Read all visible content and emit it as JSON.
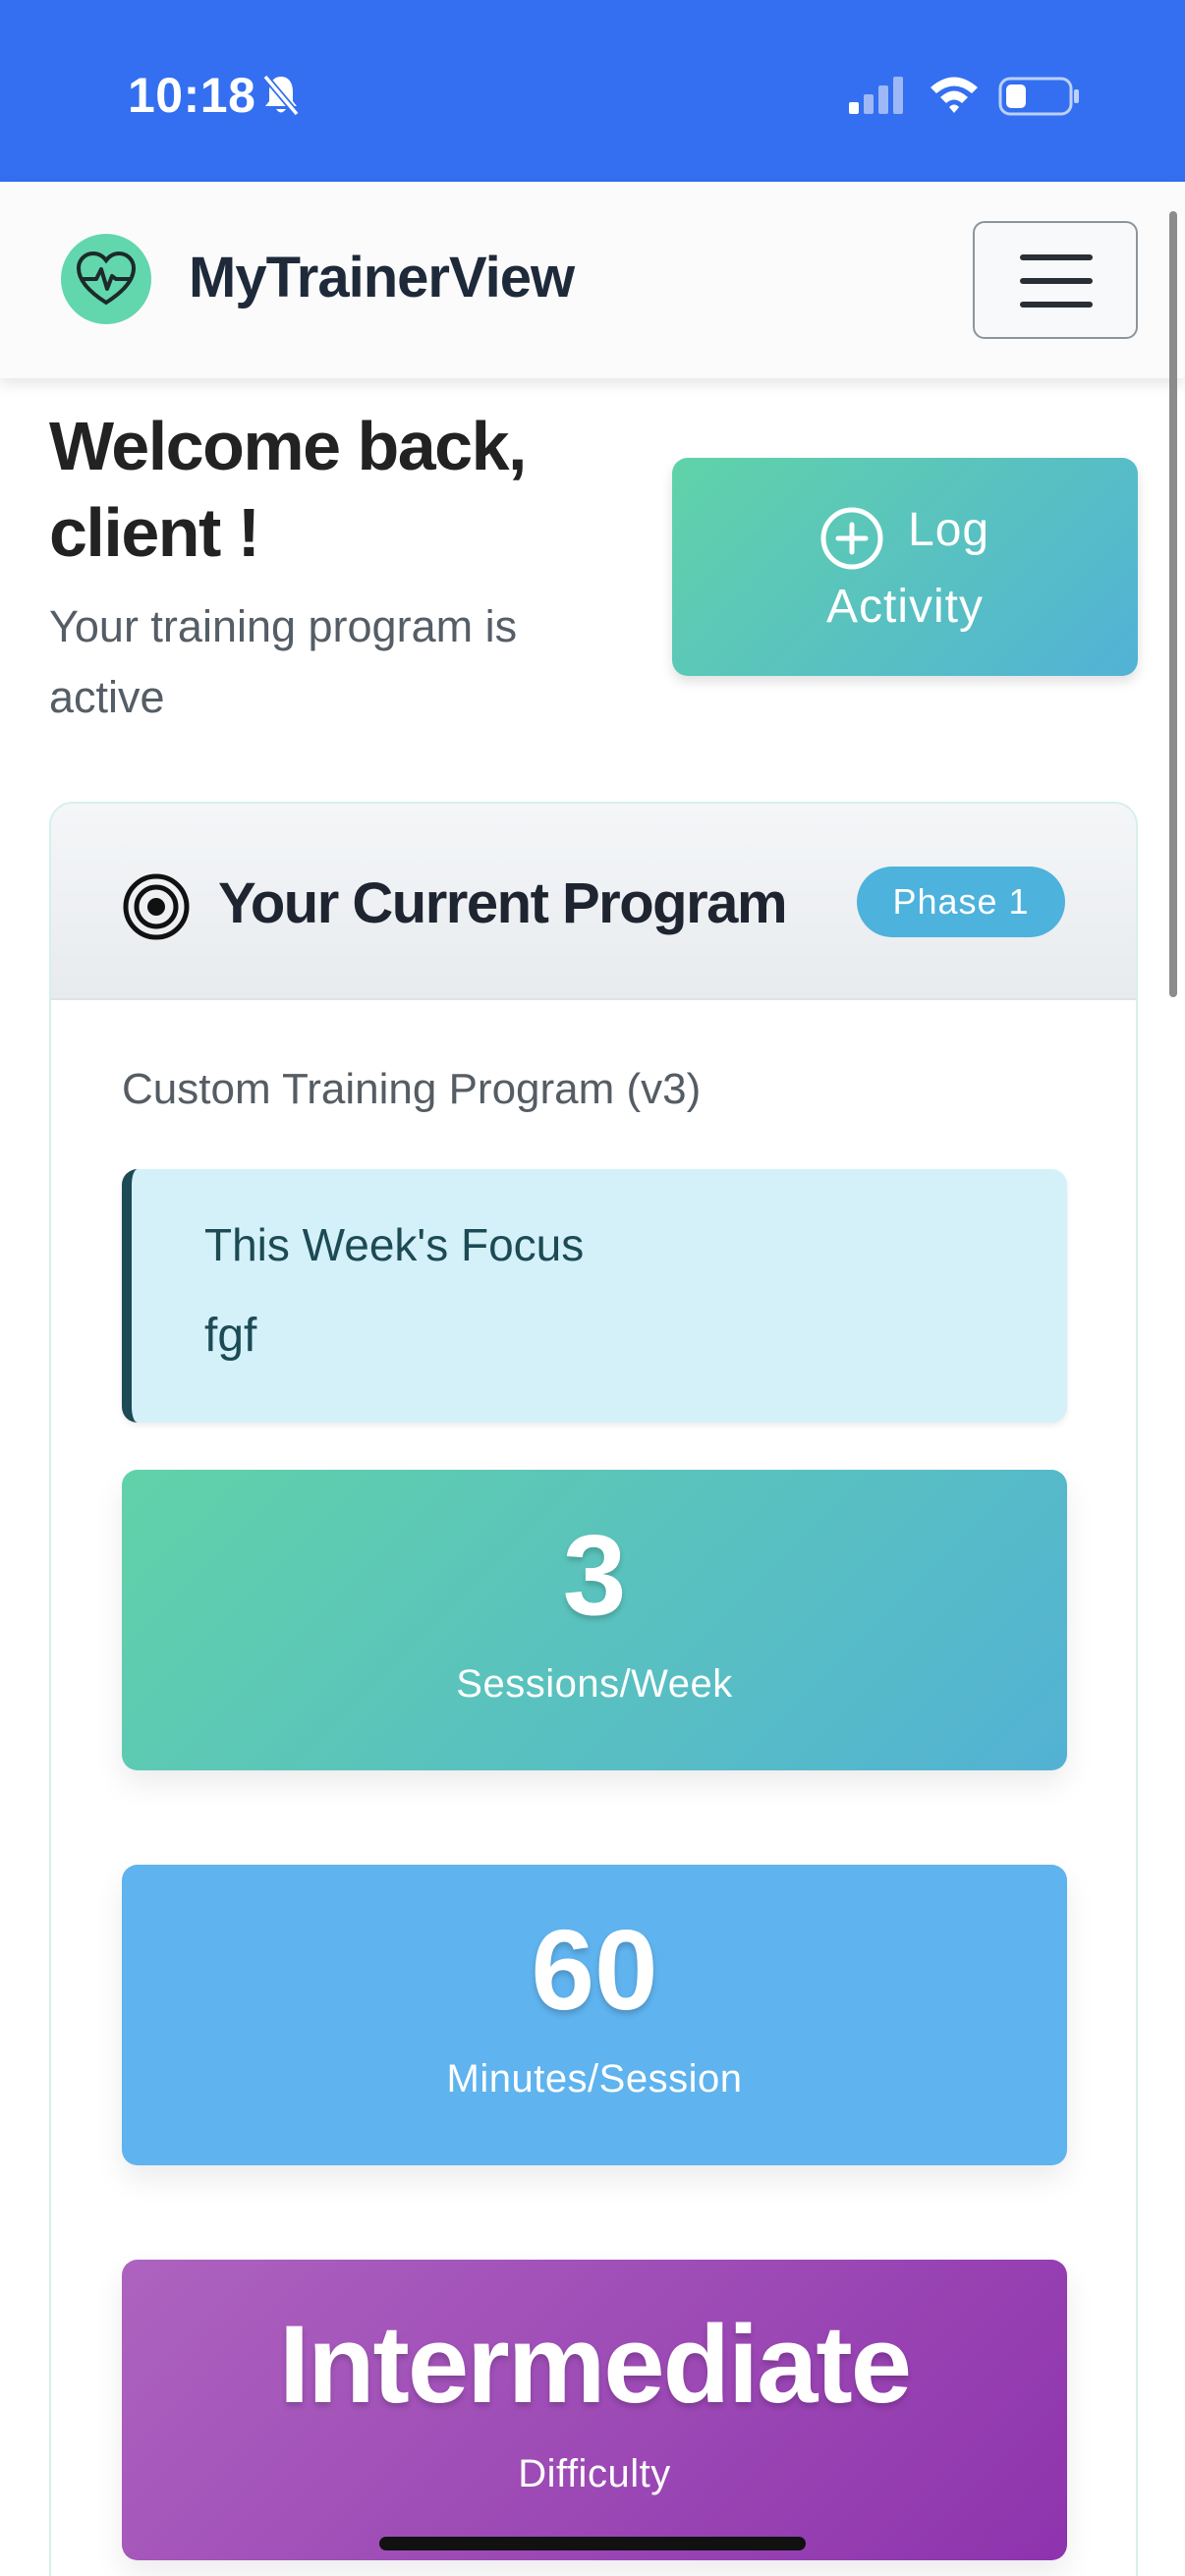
{
  "status_bar": {
    "time": "10:18",
    "icons": [
      "bell-slash-icon",
      "signal-icon",
      "wifi-icon",
      "battery-icon"
    ]
  },
  "navbar": {
    "brand_name": "MyTrainerView",
    "logo_icon": "heart-pulse-icon",
    "menu_icon": "hamburger-menu-icon"
  },
  "welcome": {
    "title": "Welcome back, client !",
    "subtitle": "Your training program is active",
    "log_button": {
      "icon": "plus-circle-icon",
      "label_line1": "Log",
      "label_line2": "Activity"
    }
  },
  "program": {
    "header_icon": "target-icon",
    "title": "Your Current Program",
    "phase": "Phase 1",
    "name": "Custom Training Program (v3)",
    "focus": {
      "title": "This Week's Focus",
      "text": "fgf"
    },
    "stats": [
      {
        "value": "3",
        "label": "Sessions/Week"
      },
      {
        "value": "60",
        "label": "Minutes/Session"
      },
      {
        "value": "Intermediate",
        "label": "Difficulty"
      }
    ]
  },
  "colors": {
    "status_bar": "#336ff0",
    "accent_green": "#60d3a8",
    "accent_teal": "#52b2d6",
    "minutes_blue": "#5fb3ee",
    "difficulty_purple": "#9c45b6",
    "focus_bg": "#d4f1f9"
  }
}
